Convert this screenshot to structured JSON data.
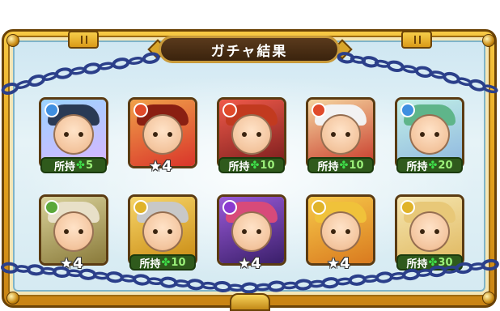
{
  "header": {
    "title": "ガチャ結果"
  },
  "colors": {
    "frame_gold": "#e6a51f",
    "panel_blue": "#cfe7f2",
    "chain_blue": "#2b3f8a",
    "owned_badge": "#2f5a1c",
    "clover_green": "#3fe04a"
  },
  "labels": {
    "owned_prefix": "所持",
    "clover": "✤",
    "star": "★"
  },
  "results": [
    {
      "element": "water",
      "element_color": "#3f8fe0",
      "bg": [
        "#9ad3ff",
        "#d8b6ff"
      ],
      "hair": "#2a3a55",
      "badge": "owned",
      "count": "5"
    },
    {
      "element": "fire",
      "element_color": "#e04a2a",
      "bg": [
        "#f0a14a",
        "#d9352a"
      ],
      "hair": "#8a1f12",
      "badge": "star",
      "count": "4"
    },
    {
      "element": "fire",
      "element_color": "#e04a2a",
      "bg": [
        "#f05a4a",
        "#7a1d1d"
      ],
      "hair": "#c23a1f",
      "badge": "owned",
      "count": "10"
    },
    {
      "element": "fire",
      "element_color": "#e04a2a",
      "bg": [
        "#f5d6a0",
        "#c83a2a"
      ],
      "hair": "#f2f2f2",
      "badge": "owned",
      "count": "10"
    },
    {
      "element": "water",
      "element_color": "#3f8fe0",
      "bg": [
        "#c2f0e6",
        "#8fb7e0"
      ],
      "hair": "#5fb58a",
      "badge": "owned",
      "count": "20"
    },
    {
      "element": "wood",
      "element_color": "#5aa83a",
      "bg": [
        "#d9d29a",
        "#8a7a3a"
      ],
      "hair": "#e8e0c8",
      "badge": "star",
      "count": "4"
    },
    {
      "element": "light",
      "element_color": "#e0b32a",
      "bg": [
        "#f7d66a",
        "#c98a12"
      ],
      "hair": "#c8c8c8",
      "badge": "owned",
      "count": "10"
    },
    {
      "element": "dark",
      "element_color": "#8a3ad0",
      "bg": [
        "#9a5ad8",
        "#3a1f6a"
      ],
      "hair": "#d84a7a",
      "badge": "star",
      "count": "4"
    },
    {
      "element": "light",
      "element_color": "#e0b32a",
      "bg": [
        "#f7c94a",
        "#d97a1f"
      ],
      "hair": "#f0c23a",
      "badge": "star",
      "count": "4"
    },
    {
      "element": "light",
      "element_color": "#e0b32a",
      "bg": [
        "#f5e6b0",
        "#e0b860"
      ],
      "hair": "#e8c878",
      "badge": "owned",
      "count": "30"
    }
  ]
}
